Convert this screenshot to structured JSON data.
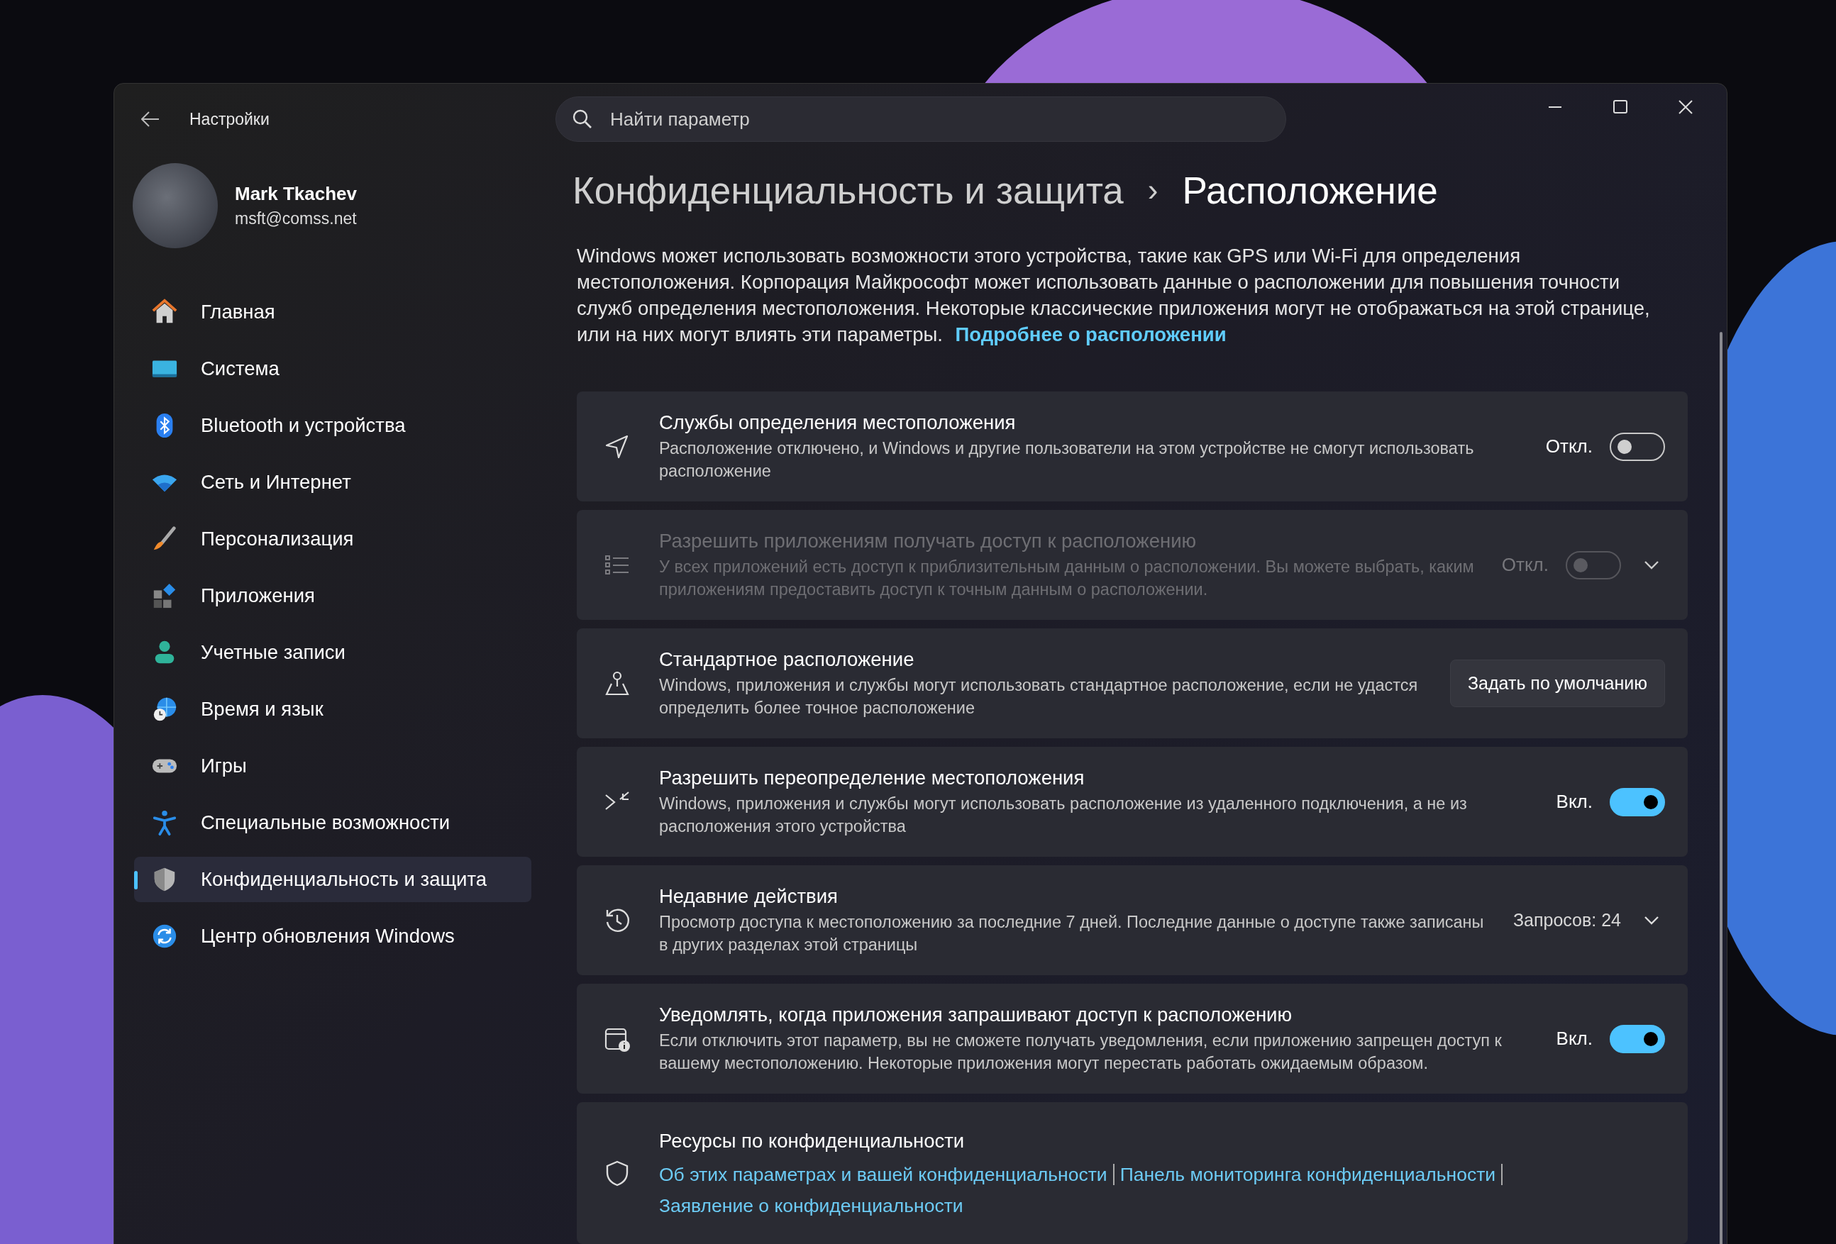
{
  "window": {
    "title": "Настройки"
  },
  "search": {
    "placeholder": "Найти параметр"
  },
  "profile": {
    "name": "Mark Tkachev",
    "email": "msft@comss.net"
  },
  "sidebar": {
    "items": [
      {
        "label": "Главная",
        "selected": false
      },
      {
        "label": "Система",
        "selected": false
      },
      {
        "label": "Bluetooth и устройства",
        "selected": false
      },
      {
        "label": "Сеть и Интернет",
        "selected": false
      },
      {
        "label": "Персонализация",
        "selected": false
      },
      {
        "label": "Приложения",
        "selected": false
      },
      {
        "label": "Учетные записи",
        "selected": false
      },
      {
        "label": "Время и язык",
        "selected": false
      },
      {
        "label": "Игры",
        "selected": false
      },
      {
        "label": "Специальные возможности",
        "selected": false
      },
      {
        "label": "Конфиденциальность и защита",
        "selected": true
      },
      {
        "label": "Центр обновления Windows",
        "selected": false
      }
    ]
  },
  "breadcrumb": {
    "parent": "Конфиденциальность и защита",
    "separator": "›",
    "current": "Расположение"
  },
  "description": {
    "text": "Windows может использовать возможности этого устройства, такие как GPS или Wi-Fi для определения местоположения. Корпорация Майкрософт может использовать данные о расположении для повышения точности служб определения местоположения. Некоторые классические приложения могут не отображаться на этой странице, или на них могут влиять эти параметры.",
    "link": "Подробнее о расположении"
  },
  "settings": [
    {
      "kind": "toggle",
      "title": "Службы определения местоположения",
      "description": "Расположение отключено, и Windows и другие пользователи на этом устройстве не смогут использовать расположение",
      "state_label": "Откл.",
      "on": false,
      "disabled": false,
      "expandable": false
    },
    {
      "kind": "toggle",
      "title": "Разрешить приложениям получать доступ к расположению",
      "description": "У всех приложений есть доступ к приблизительным данным о расположении. Вы можете выбрать, каким приложениям предоставить доступ к точным данным о расположении.",
      "state_label": "Откл.",
      "on": false,
      "disabled": true,
      "expandable": true
    },
    {
      "kind": "button",
      "title": "Стандартное расположение",
      "description": "Windows, приложения и службы могут использовать стандартное расположение, если не удастся определить более точное расположение",
      "button": "Задать по умолчанию"
    },
    {
      "kind": "toggle",
      "title": "Разрешить переопределение местоположения",
      "description": "Windows, приложения и службы могут использовать расположение из удаленного подключения, а не из расположения этого устройства",
      "state_label": "Вкл.",
      "on": true,
      "disabled": false,
      "expandable": false
    },
    {
      "kind": "count",
      "title": "Недавние действия",
      "description": "Просмотр доступа к местоположению за последние 7 дней. Последние данные о доступе также записаны в других разделах этой страницы",
      "count": "Запросов: 24",
      "expandable": true
    },
    {
      "kind": "toggle",
      "title": "Уведомлять, когда приложения запрашивают доступ к расположению",
      "description": "Если отключить этот параметр, вы не сможете получать уведомления, если приложению запрещен доступ к вашему местоположению. Некоторые приложения могут перестать работать ожидаемым образом.",
      "state_label": "Вкл.",
      "on": true,
      "disabled": false,
      "expandable": false
    },
    {
      "kind": "links",
      "title": "Ресурсы по конфиденциальности",
      "links": [
        "Об этих параметрах и вашей конфиденциальности",
        "Панель мониторинга конфиденциальности",
        "Заявление о конфиденциальности"
      ]
    }
  ]
}
